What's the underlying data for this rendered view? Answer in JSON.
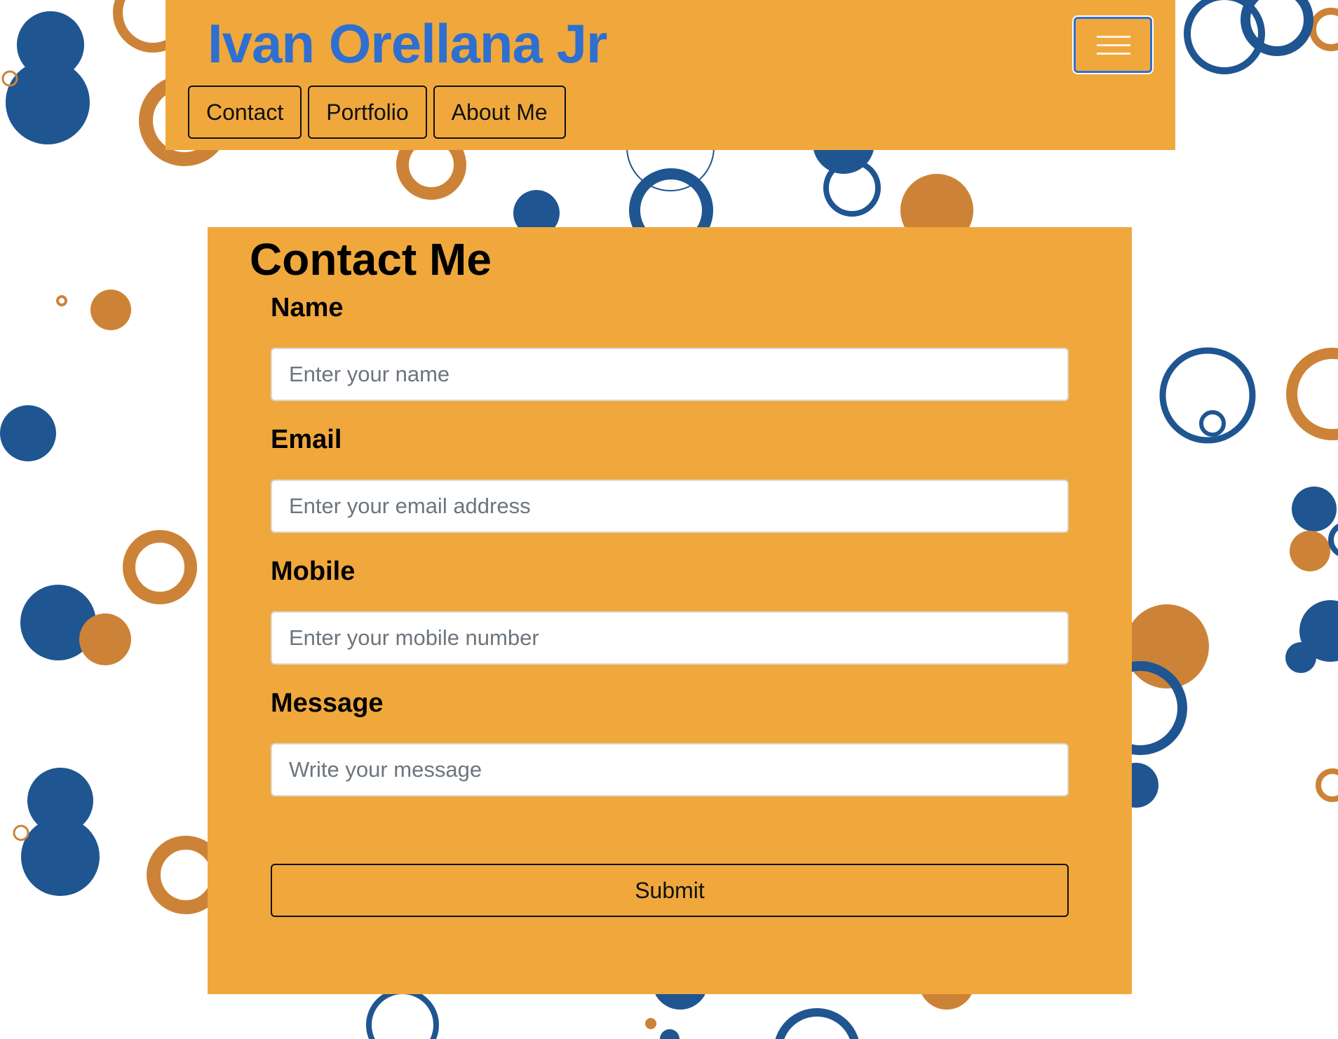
{
  "header": {
    "brand": "Ivan Orellana Jr",
    "nav": [
      "Contact",
      "Portfolio",
      "About Me"
    ],
    "menu_toggle_icon": "hamburger-icon"
  },
  "contact": {
    "title": "Contact Me",
    "fields": {
      "name": {
        "label": "Name",
        "placeholder": "Enter your name",
        "value": ""
      },
      "email": {
        "label": "Email",
        "placeholder": "Enter your email address",
        "value": ""
      },
      "mobile": {
        "label": "Mobile",
        "placeholder": "Enter your mobile number",
        "value": ""
      },
      "message": {
        "label": "Message",
        "placeholder": "Write your message",
        "value": ""
      }
    },
    "submit": "Submit"
  },
  "colors": {
    "panel": "#f0a83c",
    "brand_text": "#2f6fd0",
    "circle_blue": "#1f5591",
    "circle_orange": "#cc8337"
  }
}
